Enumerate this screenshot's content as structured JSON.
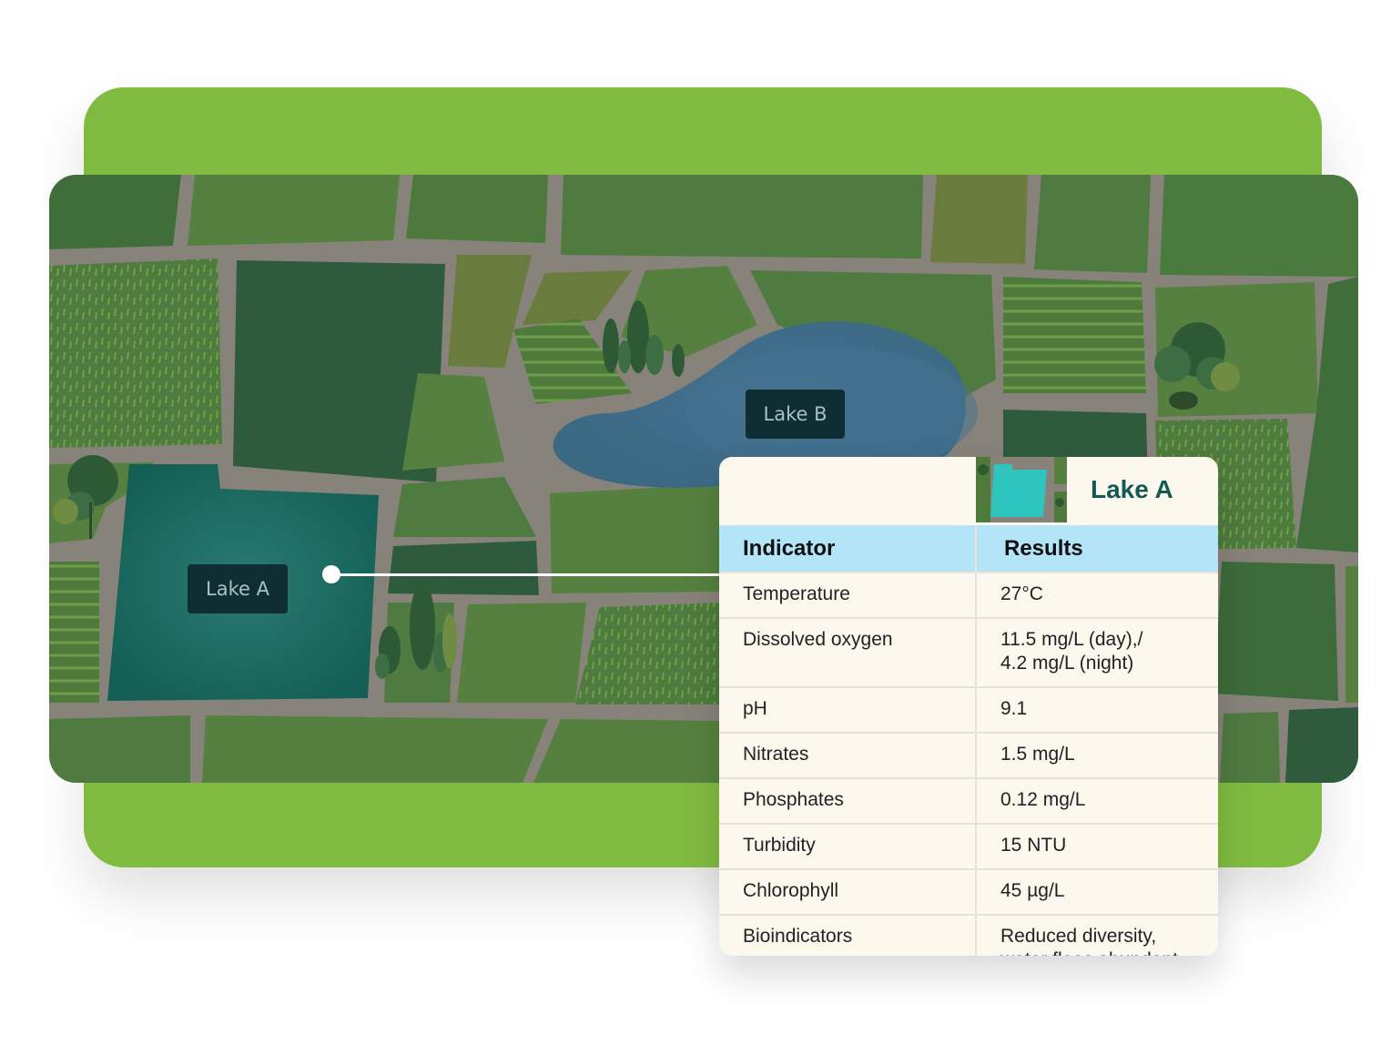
{
  "map": {
    "lakes": [
      {
        "id": "lake-a",
        "label": "Lake A"
      },
      {
        "id": "lake-b",
        "label": "Lake B"
      }
    ]
  },
  "panel": {
    "title": "Lake A",
    "table": {
      "headers": [
        "Indicator",
        "Results"
      ],
      "rows": [
        [
          "Temperature",
          "27°C"
        ],
        [
          "Dissolved oxygen",
          "11.5 mg/L (day),/\n4.2 mg/L (night)"
        ],
        [
          "pH",
          "9.1"
        ],
        [
          "Nitrates",
          "1.5 mg/L"
        ],
        [
          "Phosphates",
          "0.12 mg/L"
        ],
        [
          "Turbidity",
          "15 NTU"
        ],
        [
          "Chlorophyll",
          "45 µg/L"
        ],
        [
          "Bioindicators",
          "Reduced diversity,\nwater fleas abundant"
        ]
      ]
    }
  },
  "colors": {
    "card": "#80bb41",
    "road": "#87827a",
    "lake_a": "#18695f",
    "lake_b": "#3d6b86",
    "header_row": "#b3e4f8",
    "title": "#135a55"
  }
}
